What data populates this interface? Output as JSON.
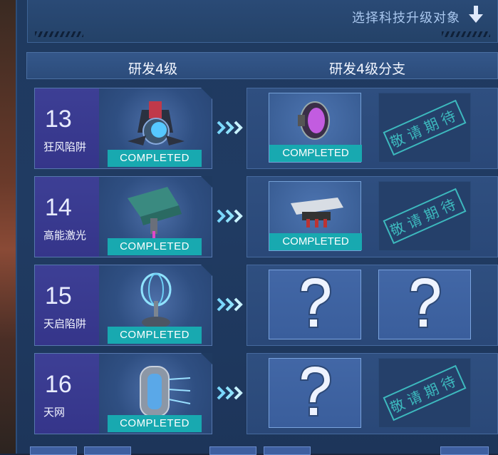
{
  "header": {
    "select_hint": "选择科技升级对象",
    "col_left": "研发4级",
    "col_right": "研发4级分支"
  },
  "rows": [
    {
      "num": "13",
      "name": "狂风陷阱",
      "status": "COMPLETED",
      "branch": [
        {
          "state": "done",
          "status": "COMPLETED"
        },
        {
          "state": "locked",
          "stamp": "敬请期待"
        }
      ]
    },
    {
      "num": "14",
      "name": "高能激光",
      "status": "COMPLETED",
      "branch": [
        {
          "state": "done",
          "status": "COMPLETED"
        },
        {
          "state": "locked",
          "stamp": "敬请期待"
        }
      ]
    },
    {
      "num": "15",
      "name": "天启陷阱",
      "status": "COMPLETED",
      "branch": [
        {
          "state": "unknown"
        },
        {
          "state": "unknown"
        }
      ]
    },
    {
      "num": "16",
      "name": "天网",
      "status": "COMPLETED",
      "branch": [
        {
          "state": "unknown"
        },
        {
          "state": "locked",
          "stamp": "敬请期待"
        }
      ]
    }
  ],
  "colors": {
    "badge_teal": "#18a9b0",
    "stamp_teal": "#3db9be",
    "panel_blue": "#2a4677"
  },
  "icons": [
    "down-arrow-icon",
    "chevron-right-icon",
    "question-mark-icon"
  ]
}
